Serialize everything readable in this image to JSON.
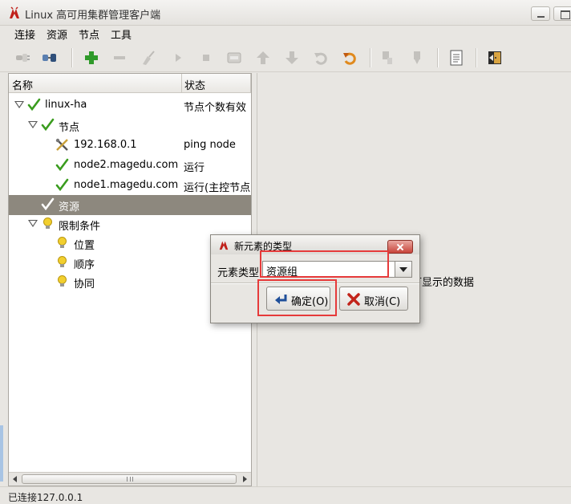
{
  "window": {
    "title": "Linux 高可用集群管理客户端"
  },
  "menu": [
    "连接",
    "资源",
    "节点",
    "工具"
  ],
  "tree": {
    "headers": {
      "name": "名称",
      "status": "状态"
    },
    "rows": [
      {
        "label": "linux-ha",
        "status": "节点个数有效"
      },
      {
        "label": "节点",
        "status": ""
      },
      {
        "label": "192.168.0.1",
        "status": "ping node"
      },
      {
        "label": "node2.magedu.com",
        "status": "运行"
      },
      {
        "label": "node1.magedu.com",
        "status": "运行(主控节点"
      },
      {
        "label": "资源",
        "status": ""
      },
      {
        "label": "限制条件",
        "status": ""
      },
      {
        "label": "位置",
        "status": ""
      },
      {
        "label": "顺序",
        "status": ""
      },
      {
        "label": "协同",
        "status": ""
      }
    ]
  },
  "right_panel": {
    "message_fragment": "可显示的数据"
  },
  "statusbar": {
    "text": "已连接127.0.0.1"
  },
  "dialog": {
    "title": "新元素的类型",
    "field_label": "元素类型",
    "field_value": "资源组",
    "ok_label": "确定(O)",
    "cancel_label": "取消(C)"
  },
  "colors": {
    "selection": "#8d887e",
    "annotation": "#e63a3a",
    "check": "#3a9c1e"
  }
}
